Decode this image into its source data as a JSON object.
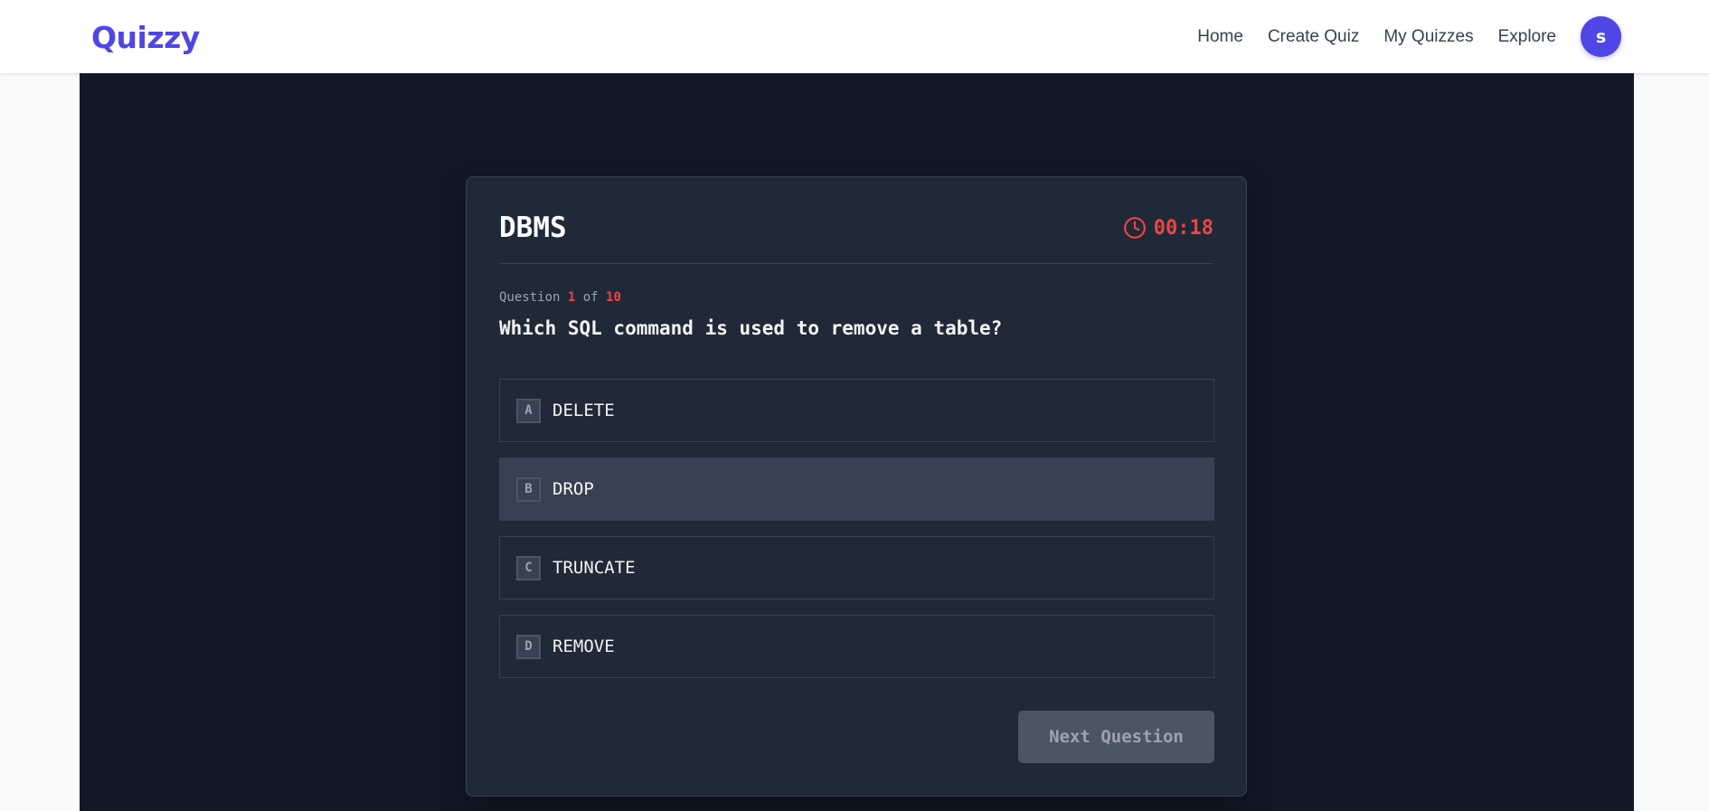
{
  "brand": {
    "name": "Quizzy",
    "color": "#4f46e5"
  },
  "nav": {
    "links": [
      "Home",
      "Create Quiz",
      "My Quizzes",
      "Explore"
    ],
    "avatar_initial": "s"
  },
  "quiz": {
    "title": "DBMS",
    "timer": "00:18",
    "progress": {
      "prefix": "Question",
      "current": "1",
      "middle": "of",
      "total": "10"
    },
    "question": "Which SQL command is used to remove a table?",
    "options": [
      {
        "letter": "A",
        "text": "DELETE",
        "selected": false
      },
      {
        "letter": "B",
        "text": "DROP",
        "selected": true
      },
      {
        "letter": "C",
        "text": "TRUNCATE",
        "selected": false
      },
      {
        "letter": "D",
        "text": "REMOVE",
        "selected": false
      }
    ],
    "next_label": "Next Question",
    "next_enabled": false
  },
  "colors": {
    "page_bg": "#f8fafc",
    "main_bg": "#111827",
    "card_bg": "#1f2937",
    "selected_option_bg": "#374151",
    "timer": "#ef4444",
    "disabled_button_bg": "#4b5563"
  }
}
